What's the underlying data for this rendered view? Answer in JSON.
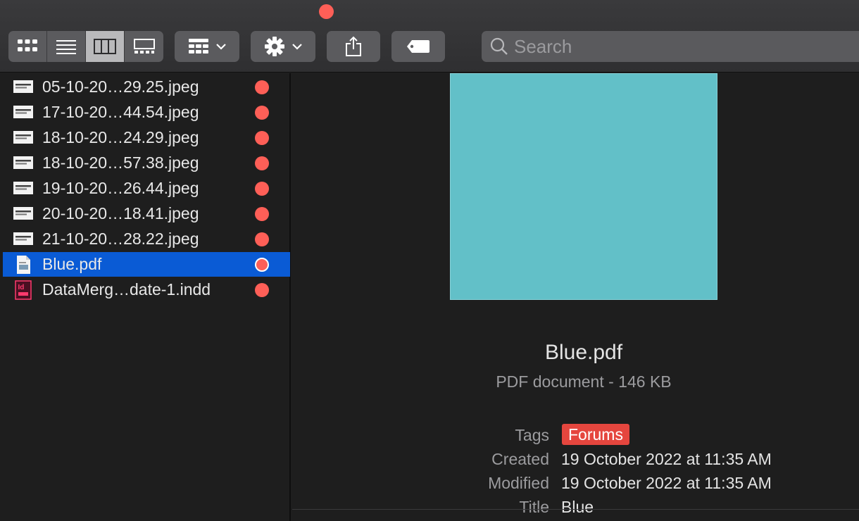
{
  "toolbar": {
    "view_buttons": [
      {
        "name": "icon-view-button",
        "icon": "grid-icon",
        "active": false
      },
      {
        "name": "list-view-button",
        "icon": "list-icon",
        "active": false
      },
      {
        "name": "column-view-button",
        "icon": "columns-icon",
        "active": true
      },
      {
        "name": "gallery-view-button",
        "icon": "gallery-icon",
        "active": false
      }
    ],
    "group_button_icon": "group-by-icon",
    "action_button_icon": "gear-icon",
    "share_button_icon": "share-icon",
    "tag_button_icon": "tag-icon",
    "search_placeholder": "Search",
    "title_dot_color": "#fe5f57"
  },
  "files": [
    {
      "name": "05-10-20…29.25.jpeg",
      "icon": "jpeg-file-icon",
      "tag_color": "#fe5f57",
      "selected": false
    },
    {
      "name": "17-10-20…44.54.jpeg",
      "icon": "jpeg-file-icon",
      "tag_color": "#fe5f57",
      "selected": false
    },
    {
      "name": "18-10-20…24.29.jpeg",
      "icon": "jpeg-file-icon",
      "tag_color": "#fe5f57",
      "selected": false
    },
    {
      "name": "18-10-20…57.38.jpeg",
      "icon": "jpeg-file-icon",
      "tag_color": "#fe5f57",
      "selected": false
    },
    {
      "name": "19-10-20…26.44.jpeg",
      "icon": "jpeg-file-icon",
      "tag_color": "#fe5f57",
      "selected": false
    },
    {
      "name": "20-10-20…18.41.jpeg",
      "icon": "jpeg-file-icon",
      "tag_color": "#fe5f57",
      "selected": false
    },
    {
      "name": "21-10-20…28.22.jpeg",
      "icon": "jpeg-file-icon",
      "tag_color": "#fe5f57",
      "selected": false
    },
    {
      "name": "Blue.pdf",
      "icon": "pdf-file-icon",
      "tag_color": "#fe5f57",
      "selected": true
    },
    {
      "name": "DataMerg…date-1.indd",
      "icon": "indesign-file-icon",
      "tag_color": "#fe5f57",
      "selected": false
    }
  ],
  "preview": {
    "thumbnail_color": "#62c0c8",
    "file_name": "Blue.pdf",
    "kind": "PDF document - 146 KB",
    "tags_label": "Tags",
    "tag": "Forums",
    "tag_color": "#e5463e",
    "created_label": "Created",
    "created_value": "19 October 2022 at 11:35 AM",
    "modified_label": "Modified",
    "modified_value": "19 October 2022 at 11:35 AM",
    "title_label": "Title",
    "title_value": "Blue"
  }
}
